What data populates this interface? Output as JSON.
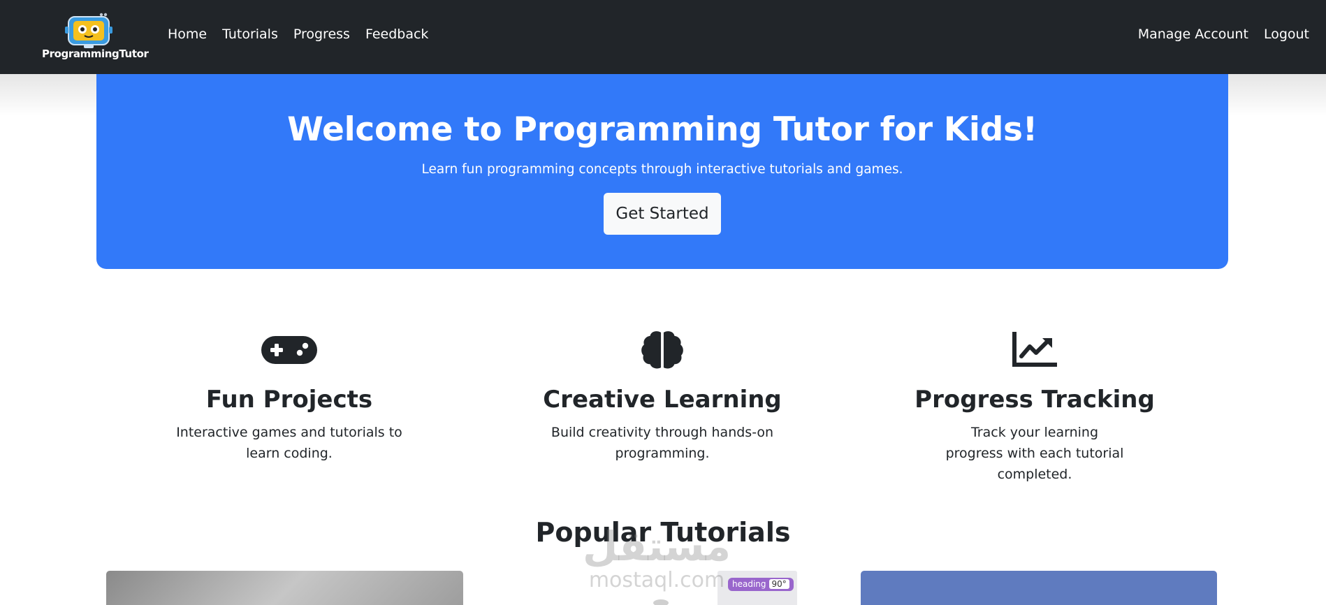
{
  "nav": {
    "brand": "ProgrammingTutor",
    "left_links": [
      "Home",
      "Tutorials",
      "Progress",
      "Feedback"
    ],
    "right_links": [
      "Manage Account",
      "Logout"
    ]
  },
  "hero": {
    "title": "Welcome to Programming Tutor for Kids!",
    "subtitle": "Learn fun programming concepts through interactive tutorials and games.",
    "button": "Get Started"
  },
  "features": [
    {
      "icon": "gamepad-icon",
      "title": "Fun Projects",
      "description": "Interactive games and tutorials to learn coding."
    },
    {
      "icon": "brain-icon",
      "title": "Creative Learning",
      "description": "Build creativity through hands-on programming."
    },
    {
      "icon": "chart-line-icon",
      "title": "Progress Tracking",
      "description": "Track your learning progress with each tutorial completed."
    }
  ],
  "popular": {
    "title": "Popular Tutorials",
    "card2_block_label": "heading",
    "card2_block_value": "90°"
  },
  "watermark": {
    "arabic": "مستقل",
    "latin": "mostaql.com"
  },
  "colors": {
    "navbar": "#212529",
    "hero": "#3279f9",
    "button": "#f8f9fa",
    "text": "#212529"
  }
}
